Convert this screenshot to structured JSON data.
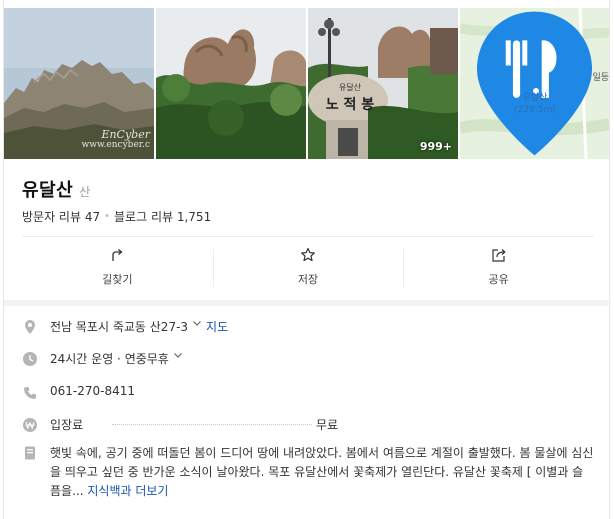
{
  "photos": {
    "photo1_watermark_line1": "EnCyber",
    "photo1_watermark_line2": "www.encyber.c",
    "photo3_count": "999+",
    "photo3_sign_small": "유달산",
    "photo3_sign_large": "노 적 봉",
    "map_pin_name": "유달산",
    "map_pin_distance": "(229.5m)",
    "map_edge_label": "일등"
  },
  "place": {
    "name": "유달산",
    "category": "산",
    "visitor_reviews": "방문자 리뷰 47",
    "blog_reviews": "블로그 리뷰 1,751"
  },
  "actions": [
    {
      "label": "길찾기",
      "icon": "directions-icon"
    },
    {
      "label": "저장",
      "icon": "star-icon"
    },
    {
      "label": "공유",
      "icon": "share-icon"
    }
  ],
  "info": {
    "address": "전남 목포시 죽교동 산27-3",
    "map_link": "지도",
    "hours": "24시간 운영 · 연중무휴",
    "phone": "061-270-8411",
    "fee_label": "입장료",
    "fee_value": "무료",
    "description": "햇빛 속에, 공기 중에 떠돌던 봄이 드디어 땅에 내려앉았다. 봄에서 여름으로 계절이 출발했다. 봄 물살에 심신을 띄우고 싶던 중 반가운 소식이 날아왔다. 목포 유달산에서 꽃축제가 열린단다. 유달산 꽃축제 [ 이별과 슬픔을...",
    "more_link": "지식백과 더보기"
  },
  "colors": {
    "link": "#1a55b3",
    "map_pin": "#1f88e5",
    "map_bg": "#e7f1df"
  }
}
